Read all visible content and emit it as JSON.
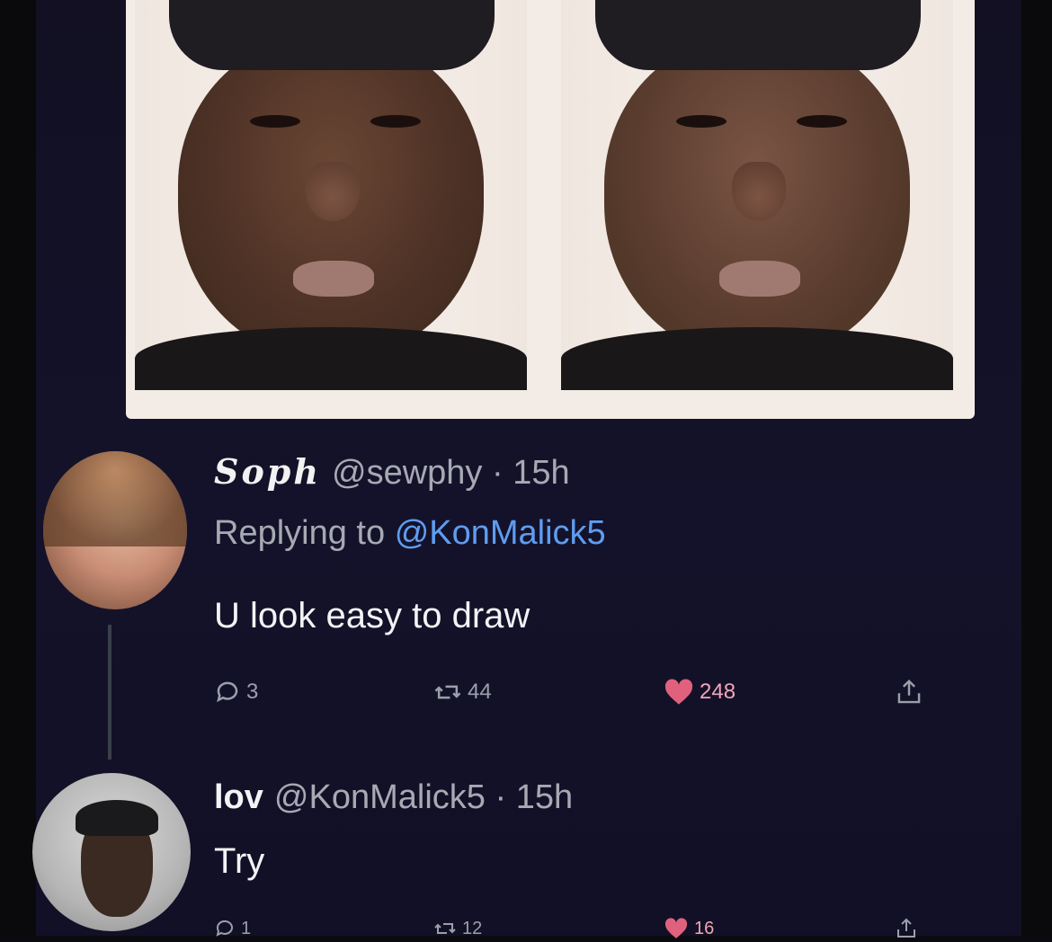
{
  "tweet": {
    "author_name": "Soph",
    "handle": "@sewphy",
    "separator": "·",
    "time": "15h",
    "replying_prefix": "Replying to",
    "replying_to": "@KonMalick5",
    "text": "U look easy to draw",
    "stats": {
      "replies": "3",
      "retweets": "44",
      "likes": "248"
    }
  },
  "reply": {
    "author_name": "lov",
    "handle": "@KonMalick5",
    "separator": "·",
    "time": "15h",
    "text": "Try",
    "stats": {
      "replies": "1",
      "retweets": "12",
      "likes": "16"
    }
  },
  "icons": {
    "comment": "comment-bubble-icon",
    "retweet": "retweet-arrows-icon",
    "like": "heart-icon",
    "share": "share-upload-icon"
  },
  "colors": {
    "background": "#13112a",
    "link": "#5e9df0",
    "like": "#f0a6b8",
    "muted": "#a7a9b3"
  }
}
